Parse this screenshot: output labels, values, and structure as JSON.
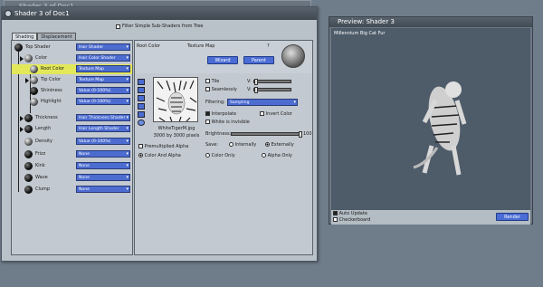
{
  "bg_window": {
    "title": "Shader 3 of Doc1"
  },
  "main_window": {
    "title": "Shader 3 of Doc1",
    "filter_label": "Filter Simple Sub-Shaders from Tree",
    "tabs": [
      "Shading",
      "Displacement"
    ],
    "tree": [
      {
        "label": "Top Shader",
        "value": "Hair Shader"
      },
      {
        "label": "Color",
        "value": "Hair Color Shader"
      },
      {
        "label": "Root Color",
        "value": "Texture Map"
      },
      {
        "label": "Tip Color",
        "value": "Texture Map"
      },
      {
        "label": "Shininess",
        "value": "Value (0-100%)"
      },
      {
        "label": "Highlight",
        "value": "Value (0-100%)"
      },
      {
        "label": "Thickness",
        "value": "Hair Thickness Shader"
      },
      {
        "label": "Length",
        "value": "Hair Length Shader"
      },
      {
        "label": "Density",
        "value": "Value (0-100%)"
      },
      {
        "label": "Frizz",
        "value": "None"
      },
      {
        "label": "Kink",
        "value": "None"
      },
      {
        "label": "Wave",
        "value": "None"
      },
      {
        "label": "Clump",
        "value": "None"
      }
    ],
    "texture": {
      "root_color_label": "Root Color",
      "texture_map_label": "Texture Map",
      "help": "?",
      "wizard_btn": "Wizard",
      "parent_btn": "Parent",
      "tile": "Tile",
      "seamlessly": "Seamlessly",
      "v1": "V:",
      "v2": "V:",
      "filtering_label": "Filtering:",
      "filtering_value": "Sampling",
      "interpolate": "Interpolate",
      "invert_color": "Invert Color",
      "white_invisible": "White is invisible",
      "brightness_label": "Brightness:",
      "brightness_value": "100",
      "file_name": "WhiteTigerM.jpg",
      "file_size": "3000 by 3000 pixels",
      "premultiplied": "Premultiplied Alpha",
      "save_label": "Save:",
      "internally": "Internally",
      "externally": "Externally",
      "color_and_alpha": "Color And Alpha",
      "color_only": "Color Only",
      "alpha_only": "Alpha Only"
    }
  },
  "preview": {
    "title": "Preview: Shader 3",
    "subject": "Millennium Big Cat Fur",
    "auto_update": "Auto Update",
    "checkerboard": "Checkerboard",
    "render_btn": "Render"
  },
  "colors": {
    "accent": "#4a6cd4",
    "selected_row": "#e3e85a"
  }
}
